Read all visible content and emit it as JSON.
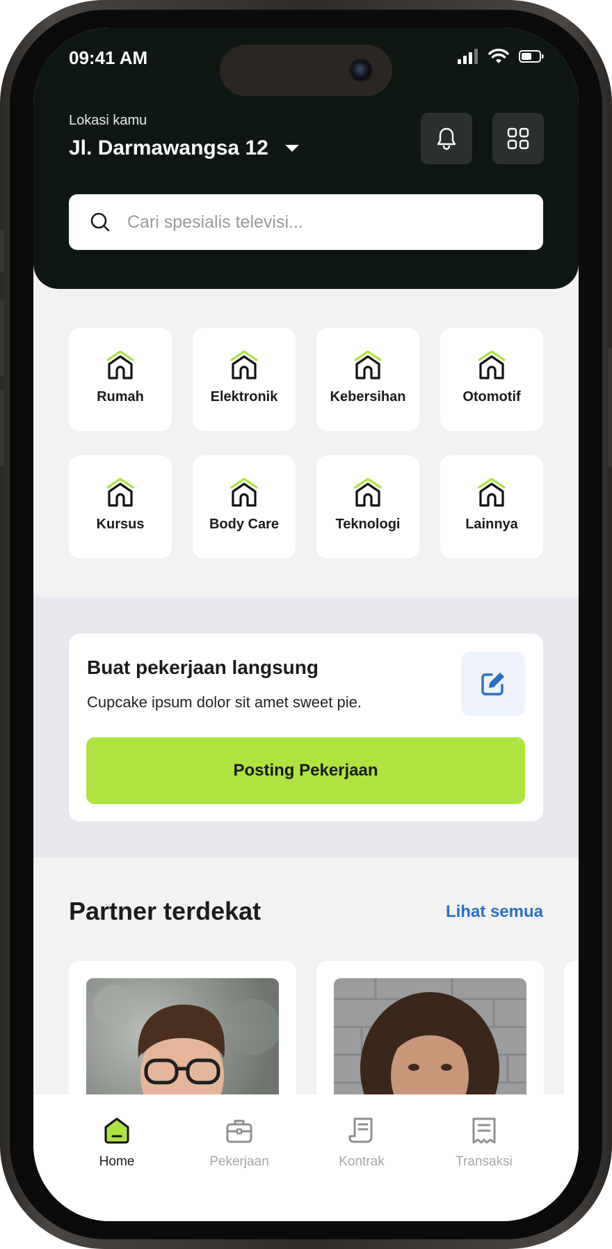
{
  "status_bar": {
    "time": "09:41 AM"
  },
  "header": {
    "location_label": "Lokasi kamu",
    "location_value": "Jl. Darmawangsa 12"
  },
  "search": {
    "placeholder": "Cari spesialis televisi..."
  },
  "categories": [
    {
      "label": "Rumah",
      "icon": "house-icon"
    },
    {
      "label": "Elektronik",
      "icon": "house-icon"
    },
    {
      "label": "Kebersihan",
      "icon": "house-icon"
    },
    {
      "label": "Otomotif",
      "icon": "house-icon"
    },
    {
      "label": "Kursus",
      "icon": "house-icon"
    },
    {
      "label": "Body Care",
      "icon": "house-icon"
    },
    {
      "label": "Teknologi",
      "icon": "house-icon"
    },
    {
      "label": "Lainnya",
      "icon": "house-icon"
    }
  ],
  "job_card": {
    "title": "Buat pekerjaan langsung",
    "subtitle": "Cupcake ipsum dolor sit amet sweet pie.",
    "button_label": "Posting Pekerjaan"
  },
  "partners": {
    "title": "Partner terdekat",
    "see_all": "Lihat semua"
  },
  "bottom_nav": [
    {
      "label": "Home",
      "icon": "home-icon",
      "active": true
    },
    {
      "label": "Pekerjaan",
      "icon": "briefcase-icon",
      "active": false
    },
    {
      "label": "Kontrak",
      "icon": "contract-icon",
      "active": false
    },
    {
      "label": "Transaksi",
      "icon": "receipt-icon",
      "active": false
    }
  ],
  "colors": {
    "header_bg": "#0f1712",
    "accent_green": "#aee440",
    "link_blue": "#2a6fc7",
    "page_bg": "#f2f2f2"
  }
}
